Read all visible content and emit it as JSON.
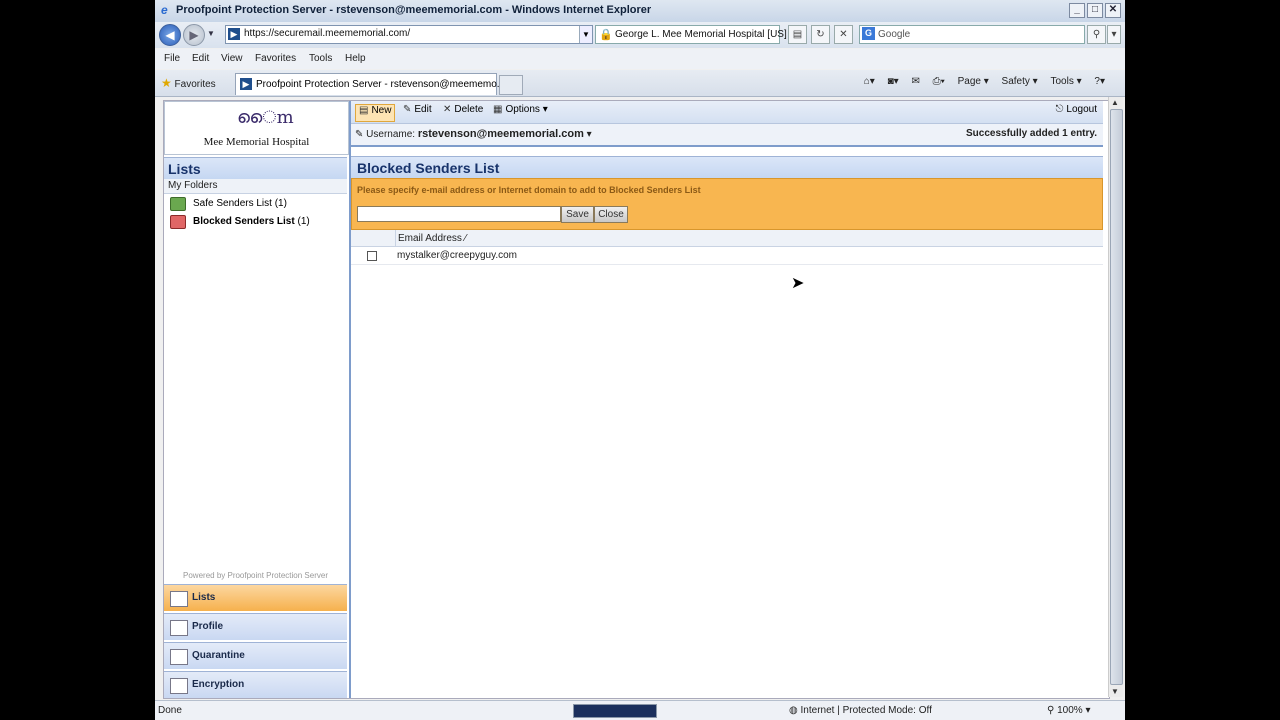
{
  "window": {
    "title": "Proofpoint Protection Server - rstevenson@meememorial.com - Windows Internet Explorer"
  },
  "address": {
    "url": "https://securemail.meememorial.com/",
    "cert": "George L. Mee Memorial Hospital [US]",
    "search_placeholder": "Google"
  },
  "menu": [
    "File",
    "Edit",
    "View",
    "Favorites",
    "Tools",
    "Help"
  ],
  "tabs": {
    "favorites": "Favorites",
    "active_tab": "Proofpoint Protection Server - rstevenson@meememo...",
    "commands": [
      "Page ▾",
      "Safety ▾",
      "Tools ▾"
    ]
  },
  "sidebar": {
    "logo_name": "Mee Memorial Hospital",
    "heading": "Lists",
    "subheading": "My Folders",
    "folders": [
      {
        "label": "Safe Senders List",
        "count": "(1)"
      },
      {
        "label": "Blocked Senders List",
        "count": "(1)"
      }
    ],
    "powered": "Powered by Proofpoint Protection Server",
    "nav": [
      {
        "label": "Lists"
      },
      {
        "label": "Profile"
      },
      {
        "label": "Quarantine"
      },
      {
        "label": "Encryption"
      }
    ]
  },
  "toolbar": {
    "new": "New",
    "edit": "Edit",
    "delete": "Delete",
    "options": "Options",
    "logout": "Logout"
  },
  "user": {
    "label": "Username:",
    "name": "rstevenson@meememorial.com",
    "message": "Successfully added 1 entry."
  },
  "list": {
    "title": "Blocked Senders List",
    "prompt": "Please specify e-mail address or Internet domain to add to Blocked Senders List",
    "save": "Save",
    "close": "Close",
    "column": "Email Address",
    "rows": [
      {
        "email": "mystalker@creepyguy.com"
      }
    ]
  },
  "status": {
    "left": "Done",
    "zone": "Internet | Protected Mode: Off",
    "zoom": "100%"
  }
}
